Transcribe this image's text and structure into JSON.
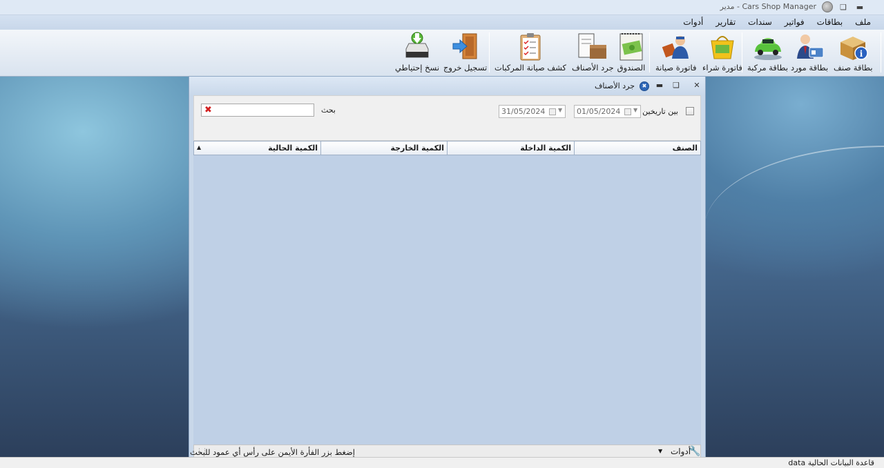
{
  "window": {
    "title": "Cars Shop Manager - مدير"
  },
  "menu": [
    "ملف",
    "بطاقات",
    "فواتير",
    "سندات",
    "تقارير",
    "أدوات"
  ],
  "toolbar": {
    "items": [
      {
        "label": "بطاقة صنف",
        "icon": "item-card-icon"
      },
      {
        "label": "بطاقة مورد",
        "icon": "supplier-card-icon"
      },
      {
        "label": "بطاقة مركبة",
        "icon": "vehicle-card-icon"
      },
      {
        "label": "فاتورة شراء",
        "icon": "purchase-invoice-icon"
      },
      {
        "label": "فاتورة صيانة",
        "icon": "maintenance-invoice-icon"
      },
      {
        "label": "الصندوق",
        "icon": "cash-box-icon"
      },
      {
        "label": "جرد الأصناف",
        "icon": "inventory-icon"
      },
      {
        "label": "كشف صيانة المركبات",
        "icon": "maintenance-report-icon"
      },
      {
        "label": "تسجيل خروج",
        "icon": "logout-icon"
      },
      {
        "label": "نسخ إحتياطي",
        "icon": "backup-icon"
      }
    ]
  },
  "child": {
    "title": "جرد الأصناف",
    "filter": {
      "between_label": "بين تاريخين",
      "date_from": "01/05/2024",
      "date_to": "31/05/2024",
      "search_label": "بحث",
      "search_value": ""
    },
    "grid": {
      "columns": [
        "الصنف",
        "الكمية الداخلة",
        "الكمية الخارجة",
        "الكمية الحالية"
      ]
    },
    "footer": {
      "tools_label": "أدوات",
      "hint": "إضغط بزر الفأرة الأيمن على رأس أي عمود للبحث"
    }
  },
  "status": {
    "db_label": "قاعدة البيانات الحالية data"
  }
}
